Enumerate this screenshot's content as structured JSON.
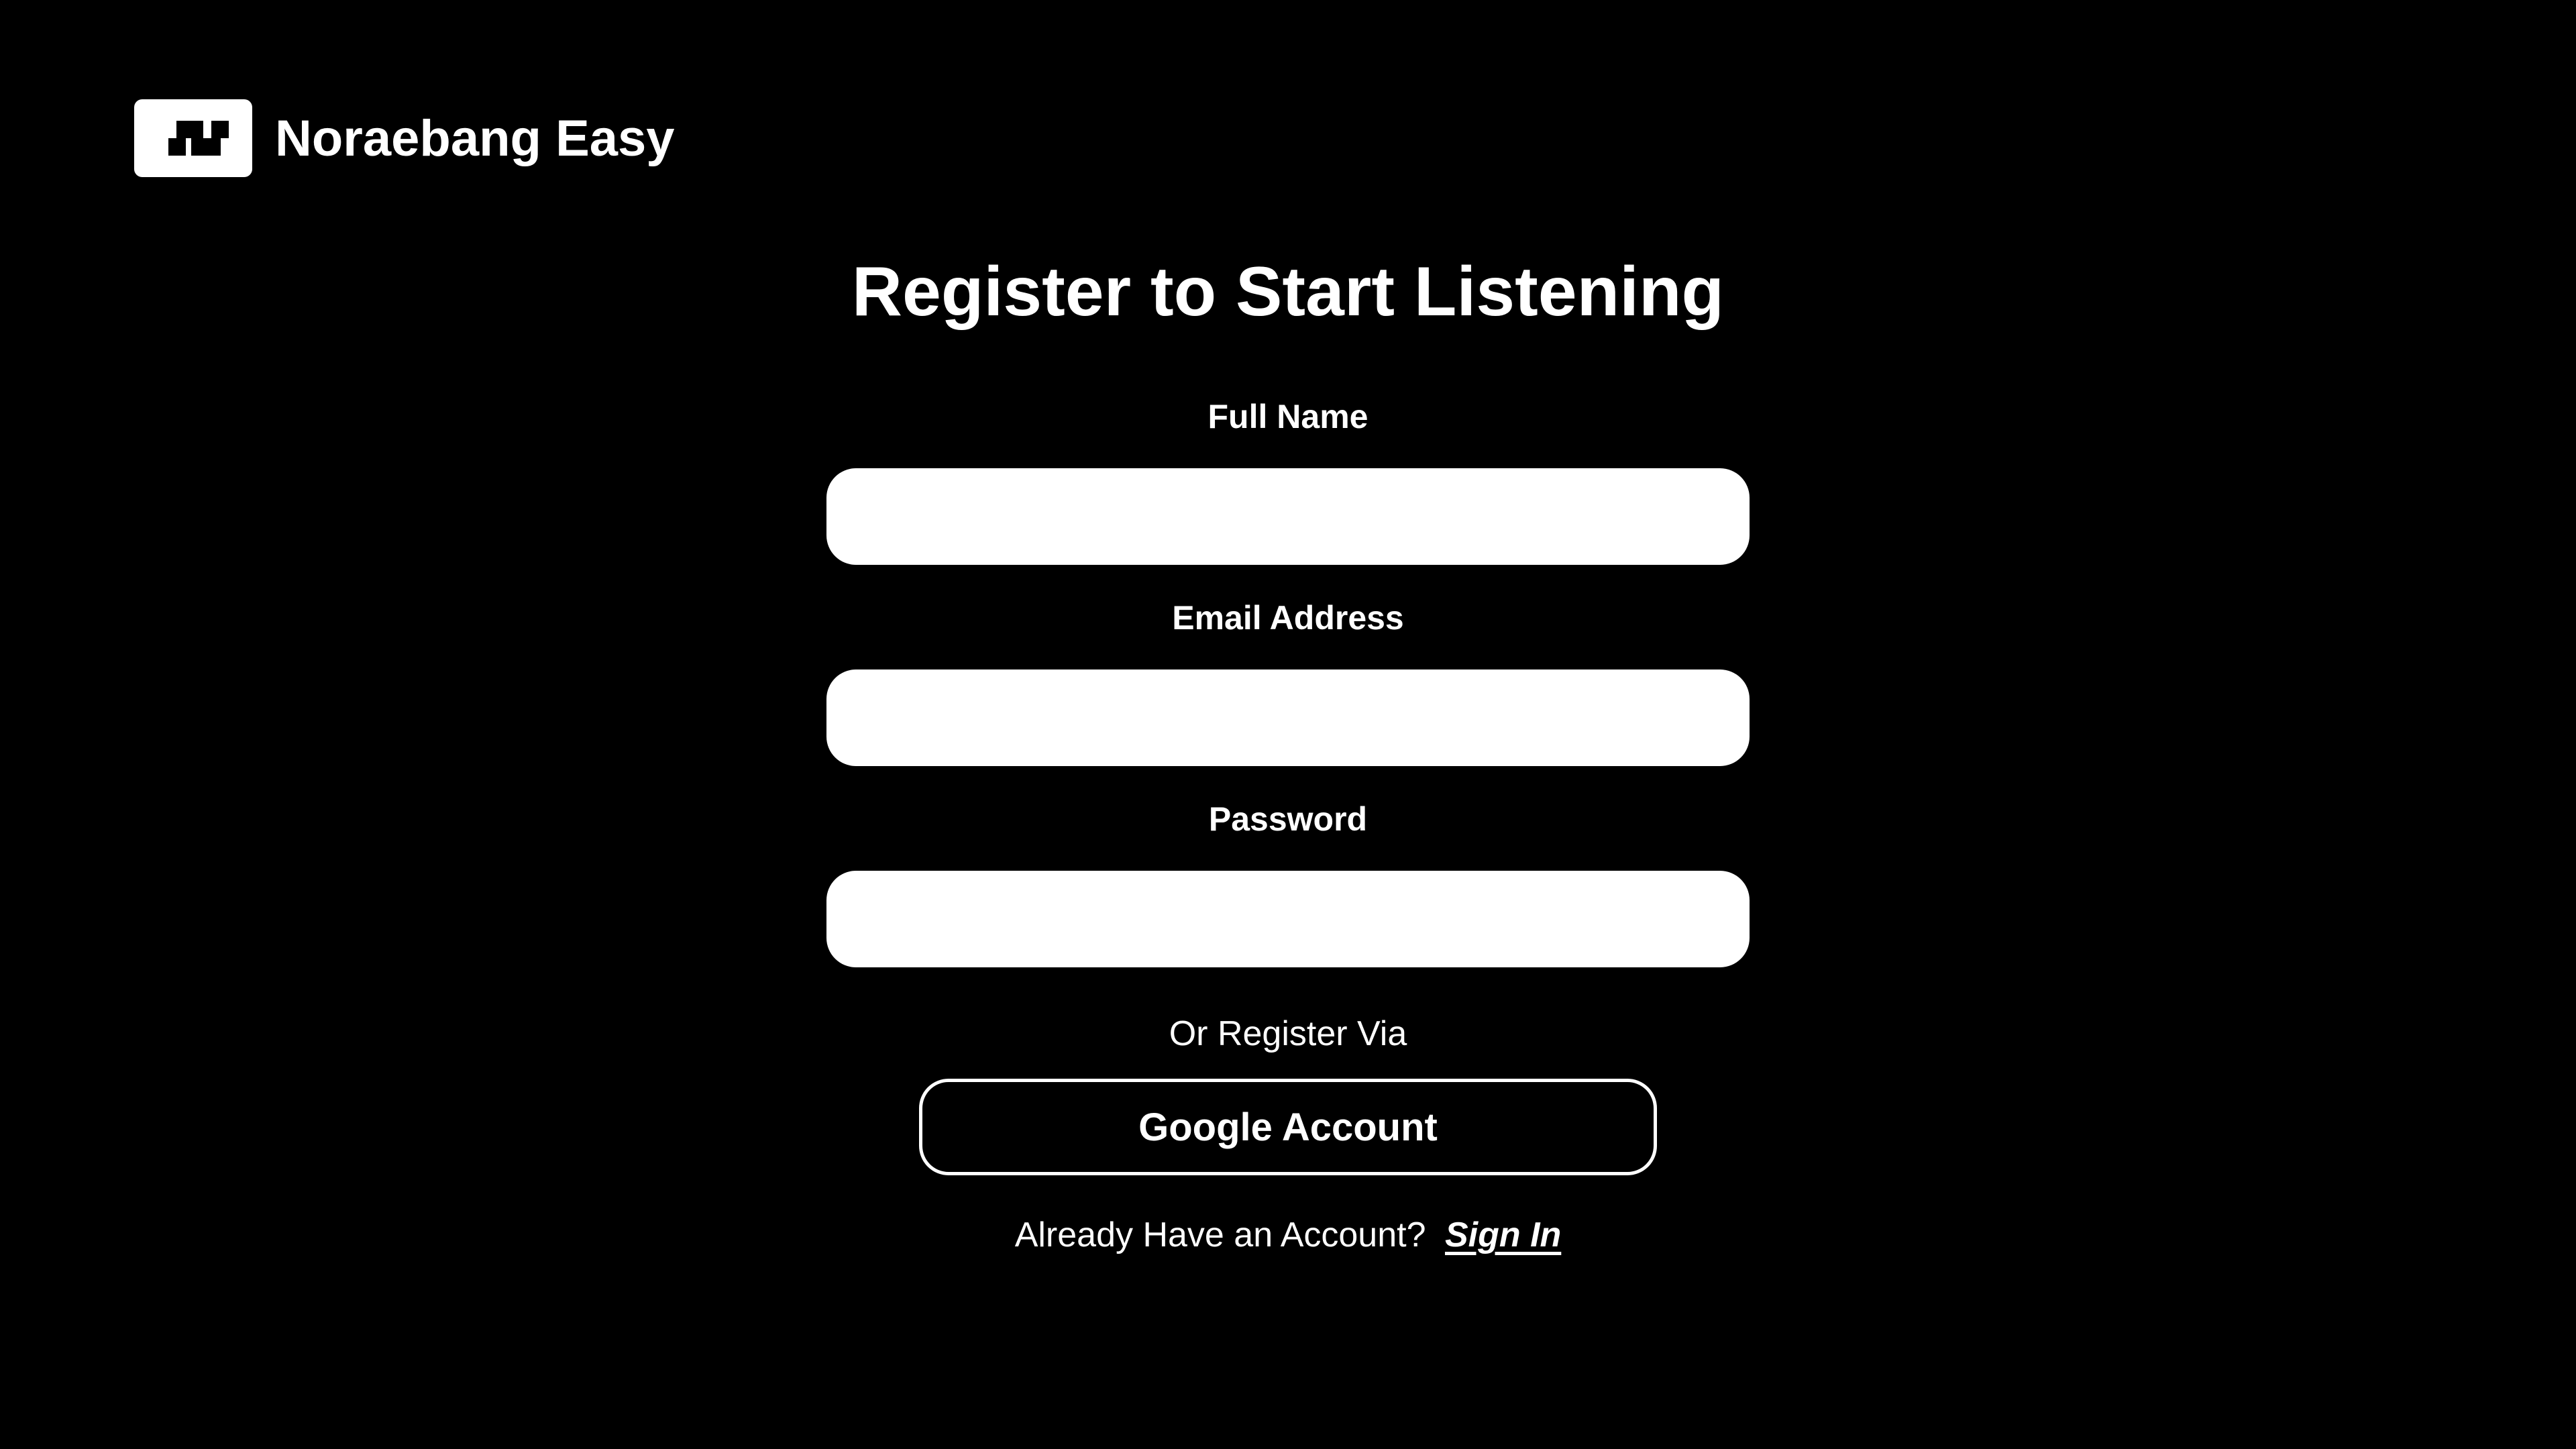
{
  "brand": {
    "name": "Noraebang Easy",
    "logo_icon": "noraebang-logo-icon",
    "logo_background": "#ffffff",
    "logo_foreground": "#000000"
  },
  "title": "Register to Start Listening",
  "form": {
    "full_name": {
      "label": "Full Name",
      "value": "",
      "placeholder": ""
    },
    "email": {
      "label": "Email Address",
      "value": "",
      "placeholder": ""
    },
    "password": {
      "label": "Password",
      "value": "",
      "placeholder": ""
    }
  },
  "alt_register": {
    "prompt": "Or Register Via",
    "google_label": "Google Account"
  },
  "signin": {
    "prompt": "Already Have an Account?",
    "link_label": "Sign In"
  },
  "colors": {
    "background": "#000000",
    "foreground": "#ffffff"
  }
}
